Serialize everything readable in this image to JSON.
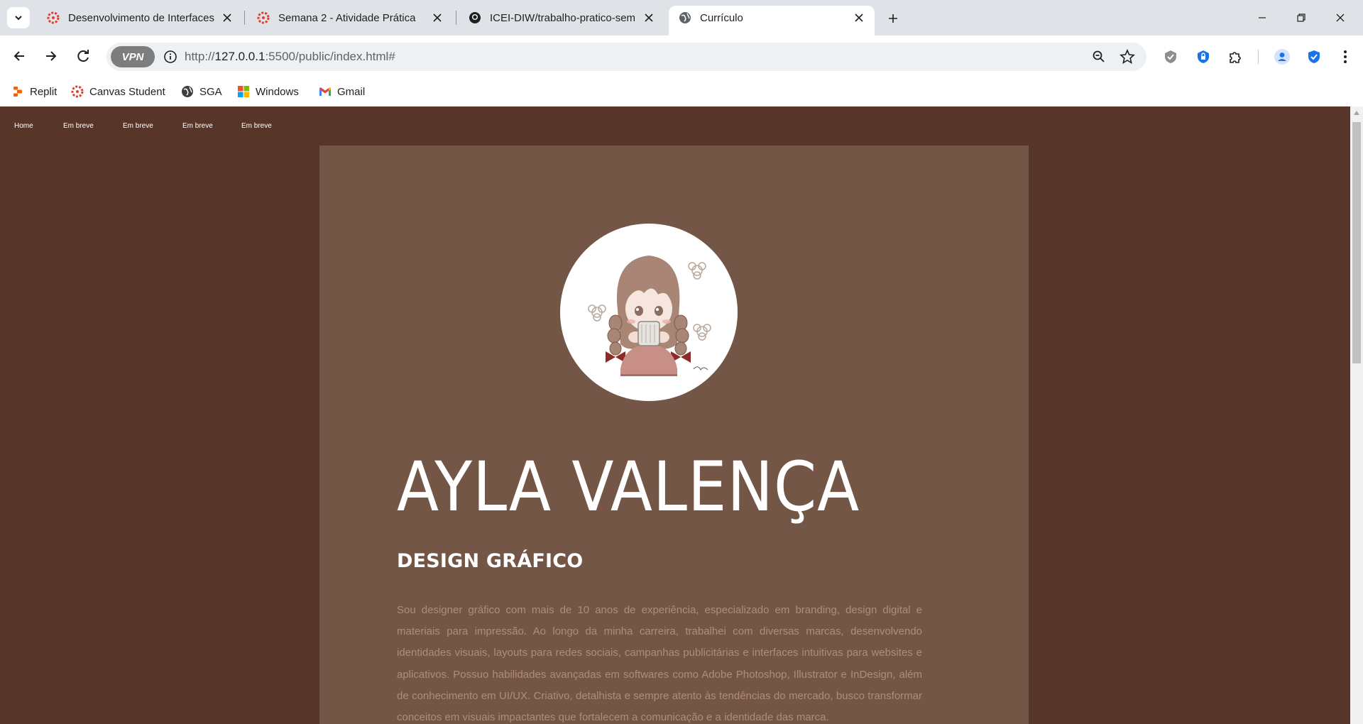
{
  "browser": {
    "tabs": [
      {
        "title": "Desenvolvimento de Interfaces",
        "icon": "canvas-icon",
        "active": false
      },
      {
        "title": "Semana 2 - Atividade Prática",
        "icon": "canvas-icon",
        "active": false
      },
      {
        "title": "ICEI-DIW/trabalho-pratico-sem",
        "icon": "github-icon",
        "active": false
      },
      {
        "title": "Currículo",
        "icon": "globe-icon",
        "active": true
      }
    ],
    "address": {
      "vpn_label": "VPN",
      "url_prefix": "http://",
      "url_host": "127.0.0.1",
      "url_rest": ":5500/public/index.html#"
    },
    "bookmarks": [
      {
        "label": "Replit",
        "icon": "replit-icon"
      },
      {
        "label": "Canvas Student",
        "icon": "canvas-icon"
      },
      {
        "label": "SGA",
        "icon": "globe-icon"
      },
      {
        "label": "Windows",
        "icon": "windows-icon"
      },
      {
        "label": "Gmail",
        "icon": "gmail-icon"
      }
    ]
  },
  "page": {
    "nav": [
      "Home",
      "Em breve",
      "Em breve",
      "Em breve",
      "Em breve"
    ],
    "name": "AYLA VALENÇA",
    "role": "DESIGN GRÁFICO",
    "bio": "Sou designer gráfico com mais de 10 anos de experiência, especializado em branding, design digital e materiais para impressão. Ao longo da minha carreira, trabalhei com diversas marcas, desenvolvendo identidades visuais, layouts para redes sociais, campanhas publicitárias e interfaces intuitivas para websites e aplicativos. Possuo habilidades avançadas em softwares como Adobe Photoshop, Illustrator e InDesign, além de conhecimento em UI/UX. Criativo, detalhista e sempre atento às tendências do mercado, busco transformar conceitos em visuais impactantes que fortalecem a comunicação e a identidade das marca.",
    "colors": {
      "background": "#573629",
      "card": "#745646",
      "bio_text": "#b08c79"
    }
  }
}
